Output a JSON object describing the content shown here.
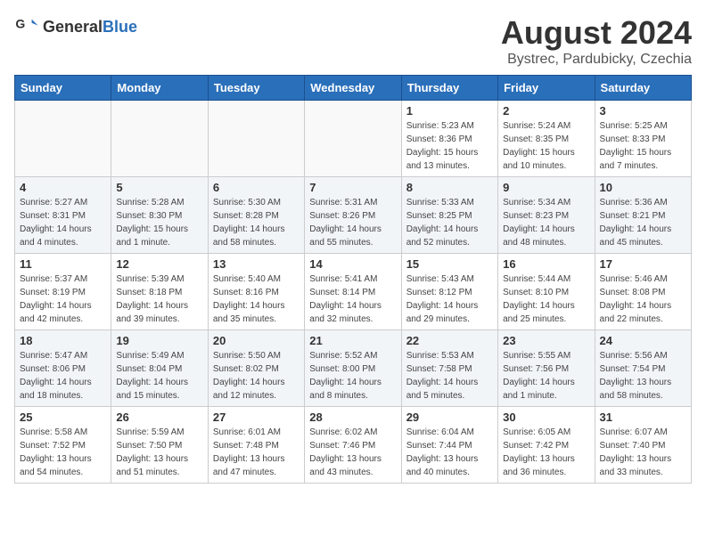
{
  "header": {
    "logo_general": "General",
    "logo_blue": "Blue",
    "main_title": "August 2024",
    "subtitle": "Bystrec, Pardubicky, Czechia"
  },
  "days_of_week": [
    "Sunday",
    "Monday",
    "Tuesday",
    "Wednesday",
    "Thursday",
    "Friday",
    "Saturday"
  ],
  "weeks": [
    [
      {
        "day": "",
        "empty": true
      },
      {
        "day": "",
        "empty": true
      },
      {
        "day": "",
        "empty": true
      },
      {
        "day": "",
        "empty": true
      },
      {
        "day": "1",
        "sunrise": "5:23 AM",
        "sunset": "8:36 PM",
        "daylight": "15 hours and 13 minutes."
      },
      {
        "day": "2",
        "sunrise": "5:24 AM",
        "sunset": "8:35 PM",
        "daylight": "15 hours and 10 minutes."
      },
      {
        "day": "3",
        "sunrise": "5:25 AM",
        "sunset": "8:33 PM",
        "daylight": "15 hours and 7 minutes."
      }
    ],
    [
      {
        "day": "4",
        "sunrise": "5:27 AM",
        "sunset": "8:31 PM",
        "daylight": "14 hours and 4 minutes."
      },
      {
        "day": "5",
        "sunrise": "5:28 AM",
        "sunset": "8:30 PM",
        "daylight": "15 hours and 1 minute."
      },
      {
        "day": "6",
        "sunrise": "5:30 AM",
        "sunset": "8:28 PM",
        "daylight": "14 hours and 58 minutes."
      },
      {
        "day": "7",
        "sunrise": "5:31 AM",
        "sunset": "8:26 PM",
        "daylight": "14 hours and 55 minutes."
      },
      {
        "day": "8",
        "sunrise": "5:33 AM",
        "sunset": "8:25 PM",
        "daylight": "14 hours and 52 minutes."
      },
      {
        "day": "9",
        "sunrise": "5:34 AM",
        "sunset": "8:23 PM",
        "daylight": "14 hours and 48 minutes."
      },
      {
        "day": "10",
        "sunrise": "5:36 AM",
        "sunset": "8:21 PM",
        "daylight": "14 hours and 45 minutes."
      }
    ],
    [
      {
        "day": "11",
        "sunrise": "5:37 AM",
        "sunset": "8:19 PM",
        "daylight": "14 hours and 42 minutes."
      },
      {
        "day": "12",
        "sunrise": "5:39 AM",
        "sunset": "8:18 PM",
        "daylight": "14 hours and 39 minutes."
      },
      {
        "day": "13",
        "sunrise": "5:40 AM",
        "sunset": "8:16 PM",
        "daylight": "14 hours and 35 minutes."
      },
      {
        "day": "14",
        "sunrise": "5:41 AM",
        "sunset": "8:14 PM",
        "daylight": "14 hours and 32 minutes."
      },
      {
        "day": "15",
        "sunrise": "5:43 AM",
        "sunset": "8:12 PM",
        "daylight": "14 hours and 29 minutes."
      },
      {
        "day": "16",
        "sunrise": "5:44 AM",
        "sunset": "8:10 PM",
        "daylight": "14 hours and 25 minutes."
      },
      {
        "day": "17",
        "sunrise": "5:46 AM",
        "sunset": "8:08 PM",
        "daylight": "14 hours and 22 minutes."
      }
    ],
    [
      {
        "day": "18",
        "sunrise": "5:47 AM",
        "sunset": "8:06 PM",
        "daylight": "14 hours and 18 minutes."
      },
      {
        "day": "19",
        "sunrise": "5:49 AM",
        "sunset": "8:04 PM",
        "daylight": "14 hours and 15 minutes."
      },
      {
        "day": "20",
        "sunrise": "5:50 AM",
        "sunset": "8:02 PM",
        "daylight": "14 hours and 12 minutes."
      },
      {
        "day": "21",
        "sunrise": "5:52 AM",
        "sunset": "8:00 PM",
        "daylight": "14 hours and 8 minutes."
      },
      {
        "day": "22",
        "sunrise": "5:53 AM",
        "sunset": "7:58 PM",
        "daylight": "14 hours and 5 minutes."
      },
      {
        "day": "23",
        "sunrise": "5:55 AM",
        "sunset": "7:56 PM",
        "daylight": "14 hours and 1 minute."
      },
      {
        "day": "24",
        "sunrise": "5:56 AM",
        "sunset": "7:54 PM",
        "daylight": "13 hours and 58 minutes."
      }
    ],
    [
      {
        "day": "25",
        "sunrise": "5:58 AM",
        "sunset": "7:52 PM",
        "daylight": "13 hours and 54 minutes."
      },
      {
        "day": "26",
        "sunrise": "5:59 AM",
        "sunset": "7:50 PM",
        "daylight": "13 hours and 51 minutes."
      },
      {
        "day": "27",
        "sunrise": "6:01 AM",
        "sunset": "7:48 PM",
        "daylight": "13 hours and 47 minutes."
      },
      {
        "day": "28",
        "sunrise": "6:02 AM",
        "sunset": "7:46 PM",
        "daylight": "13 hours and 43 minutes."
      },
      {
        "day": "29",
        "sunrise": "6:04 AM",
        "sunset": "7:44 PM",
        "daylight": "13 hours and 40 minutes."
      },
      {
        "day": "30",
        "sunrise": "6:05 AM",
        "sunset": "7:42 PM",
        "daylight": "13 hours and 36 minutes."
      },
      {
        "day": "31",
        "sunrise": "6:07 AM",
        "sunset": "7:40 PM",
        "daylight": "13 hours and 33 minutes."
      }
    ]
  ]
}
